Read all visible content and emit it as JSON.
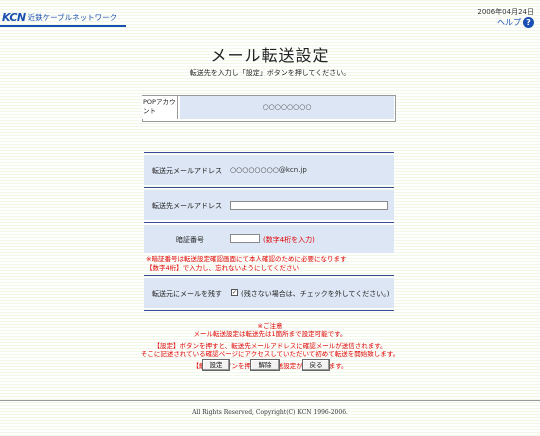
{
  "header": {
    "logo_mark": "KCN",
    "logo_name": "近鉄ケーブルネットワーク",
    "date": "2006年04月24日",
    "help_label": "ヘルプ",
    "help_glyph": "?"
  },
  "page": {
    "title": "メール転送設定",
    "subtitle": "転送先を入力し「設定」ボタンを押してください。"
  },
  "pop": {
    "label": "POPアカウント",
    "value": "○○○○○○○○"
  },
  "form": {
    "source_label": "転送元メールアドレス",
    "source_value": "○○○○○○○○@kcn.jp",
    "dest_label": "転送先メールアドレス",
    "dest_value": "",
    "pin_label": "暗証番号",
    "pin_value": "",
    "pin_hint": "(数字4桁を入力)",
    "pin_note_1": "※暗証番号は転送設定確認画面にて本人確認のために必要になります",
    "pin_note_2": "【数字4桁】で入力し、忘れないようにしてください",
    "keep_label": "転送元にメールを残す",
    "keep_checked": true,
    "keep_check_glyph": "✓",
    "keep_hint": "(残さない場合は、チェックを外してください。)"
  },
  "notice": {
    "line1": "※ご注意",
    "line2": "メール転送設定は転送先は1箇所まで設定可能です。",
    "line3": "【設定】ボタンを押すと、転送先メールアドレスに確認メールが送信されます。",
    "line4": "そこに記述されている確認ページにアクセスしていただいて初めて転送を開始致します。",
    "line5": "【解除】ボタンを押すと、転送設定が解除されます。"
  },
  "buttons": {
    "set": "設定",
    "cancel": "解除",
    "back": "戻る"
  },
  "footer": {
    "copyright": "All Rights Reserved, Copyright(C) KCN 1996-2006."
  },
  "colors": {
    "brand_blue": "#1a4fb3",
    "row_bg": "#dde6f4",
    "alert_red": "#e00000"
  }
}
